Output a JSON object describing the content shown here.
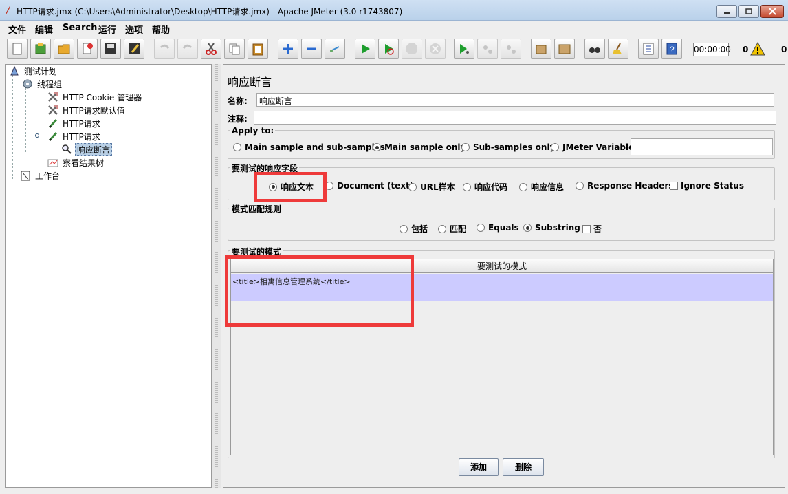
{
  "window": {
    "title": "HTTP请求.jmx (C:\\Users\\Administrator\\Desktop\\HTTP请求.jmx) - Apache JMeter (3.0 r1743807)"
  },
  "menu": [
    "文件",
    "编辑",
    "Search",
    "运行",
    "选项",
    "帮助"
  ],
  "toolbar": {
    "timer": "00:00:00",
    "warning_count": "0",
    "active_count": "0"
  },
  "tree": [
    {
      "label": "测试计划",
      "icon": "test-plan-icon"
    },
    {
      "label": "线程组",
      "icon": "thread-group-gear-icon"
    },
    {
      "label": "HTTP Cookie 管理器",
      "icon": "tools-icon"
    },
    {
      "label": "HTTP请求默认值",
      "icon": "tools-icon"
    },
    {
      "label": "HTTP请求",
      "icon": "sampler-pen-icon"
    },
    {
      "label": "HTTP请求",
      "icon": "sampler-pen-icon"
    },
    {
      "label": "响应断言",
      "icon": "magnifier-icon"
    },
    {
      "label": "察看结果树",
      "icon": "listener-graph-icon"
    },
    {
      "label": "工作台",
      "icon": "workbench-icon"
    }
  ],
  "panel": {
    "title": "响应断言",
    "name_label": "名称:",
    "name_value": "响应断言",
    "comment_label": "注释:",
    "comment_value": "",
    "apply_to": {
      "title": "Apply to:",
      "options": [
        "Main sample and sub-samples",
        "Main sample only",
        "Sub-samples only",
        "JMeter Variable"
      ],
      "selected": "Main sample only",
      "variable_value": ""
    },
    "response_field": {
      "title": "要测试的响应字段",
      "options": [
        "响应文本",
        "Document (text)",
        "URL样本",
        "响应代码",
        "响应信息",
        "Response Headers"
      ],
      "selected": "响应文本",
      "ignore_status": "Ignore Status"
    },
    "pattern_rule": {
      "title": "模式匹配规则",
      "options": [
        "包括",
        "匹配",
        "Equals",
        "Substring"
      ],
      "selected": "Substring",
      "not_label": "否"
    },
    "patterns": {
      "title": "要测试的模式",
      "column": "要测试的模式",
      "rows": [
        "<title>相寓信息管理系统</title>"
      ]
    },
    "add_button": "添加",
    "delete_button": "删除"
  },
  "colors": {
    "highlight": "#ee3a3a",
    "row_selected": "#cccbff"
  }
}
